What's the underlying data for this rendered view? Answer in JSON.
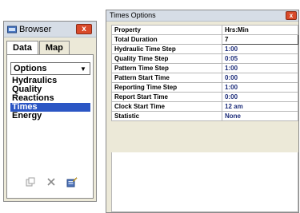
{
  "browser": {
    "title": "Browser",
    "close": "x",
    "tabs": [
      {
        "label": "Data",
        "active": true
      },
      {
        "label": "Map",
        "active": false
      }
    ],
    "dropdown": {
      "selected": "Options"
    },
    "options": [
      "Hydraulics",
      "Quality",
      "Reactions",
      "Times",
      "Energy"
    ],
    "selected_option": "Times",
    "toolbar": [
      "add-icon",
      "delete-icon",
      "edit-icon"
    ]
  },
  "times_options": {
    "title": "Times Options",
    "close": "x",
    "header": {
      "property": "Property",
      "value": "Hrs:Min"
    },
    "rows": [
      {
        "property": "Total Duration",
        "value": "7"
      },
      {
        "property": "Hydraulic Time Step",
        "value": "1:00"
      },
      {
        "property": "Quality Time Step",
        "value": "0:05"
      },
      {
        "property": "Pattern Time Step",
        "value": "1:00"
      },
      {
        "property": "Pattern Start Time",
        "value": "0:00"
      },
      {
        "property": "Reporting Time Step",
        "value": "1:00"
      },
      {
        "property": "Report Start Time",
        "value": "0:00"
      },
      {
        "property": "Clock Start Time",
        "value": "12 am"
      },
      {
        "property": "Statistic",
        "value": "None"
      }
    ]
  },
  "colors": {
    "selection": "#2b56c4",
    "close": "#d94a2a",
    "value_text": "#1d2d7a"
  }
}
